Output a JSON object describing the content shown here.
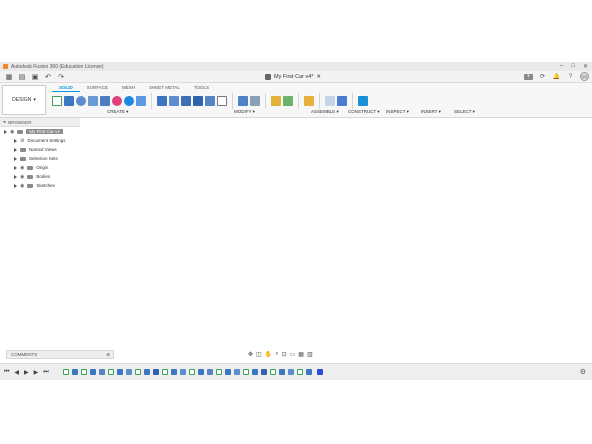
{
  "window": {
    "title": "Autodesk Fusion 360 (Education License)",
    "controls": [
      "–",
      "□",
      "✕"
    ]
  },
  "quickbar": {
    "icons": [
      "grid-icon",
      "file-icon",
      "save-icon",
      "undo-icon",
      "redo-icon"
    ],
    "document_tab": "My First Car v4*",
    "right_icons": [
      "+",
      "⟳",
      "🔔",
      "?"
    ],
    "avatar": "CC"
  },
  "ribbon": {
    "workspace": "DESIGN",
    "tabs": [
      "SOLID",
      "SURFACE",
      "MESH",
      "SHEET METAL",
      "TOOLS"
    ],
    "active_tab": "SOLID",
    "groups": [
      "CREATE ▾",
      "MODIFY ▾",
      "ASSEMBLE ▾",
      "CONSTRUCT ▾",
      "INSPECT ▾",
      "INSERT ▾",
      "SELECT ▾"
    ]
  },
  "browser": {
    "title": "BROWSER",
    "root": "My First Car v4",
    "items": [
      "Document Settings",
      "Named Views",
      "Selection Sets",
      "Origin",
      "Bodies",
      "Sketches"
    ]
  },
  "comments": {
    "label": "COMMENTS"
  },
  "colors": {
    "accent": "#0696d7",
    "model_body": "#6e675f",
    "plane": "#f0c058",
    "timeline_marker": "#2a4fd6"
  }
}
